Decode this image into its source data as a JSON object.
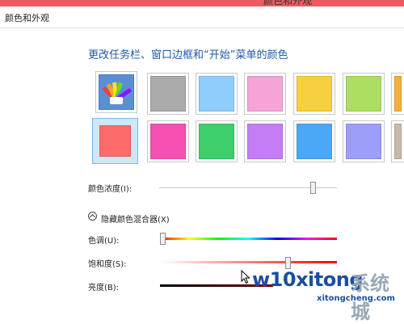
{
  "window": {
    "title": "颜色和外观"
  },
  "menubar": {
    "label": "颜色和外观"
  },
  "heading": "更改任务栏、窗口边框和“开始”菜单的颜色",
  "swatches": {
    "row1": [
      "#ababab",
      "#8fcdfc",
      "#f6a3d8",
      "#f7d040",
      "#aedd63",
      "#f2b13e"
    ],
    "row2": [
      "#fd6c6a",
      "#f750b2",
      "#3fcf6c",
      "#c47df5",
      "#4aa8f7",
      "#9d9ef9",
      "#c8b9ab"
    ],
    "selected_color": "#fd6c6a"
  },
  "color_intensity": {
    "label": "颜色浓度(I):",
    "value": 0.86
  },
  "mixer": {
    "label": "隐藏颜色混合器(X)"
  },
  "hue": {
    "label": "色调(U):",
    "value": 0.0
  },
  "saturation": {
    "label": "饱和度(S):",
    "value": 0.72
  },
  "brightness": {
    "label": "亮度(B):"
  },
  "watermark": {
    "brand": "w10xitong",
    "site_cn": "系统城",
    "url": "xitongcheng.com"
  },
  "colors": {
    "title_bar": "#ee5a61",
    "heading": "#1e5aa8",
    "selected_border": "#7bbadf"
  }
}
